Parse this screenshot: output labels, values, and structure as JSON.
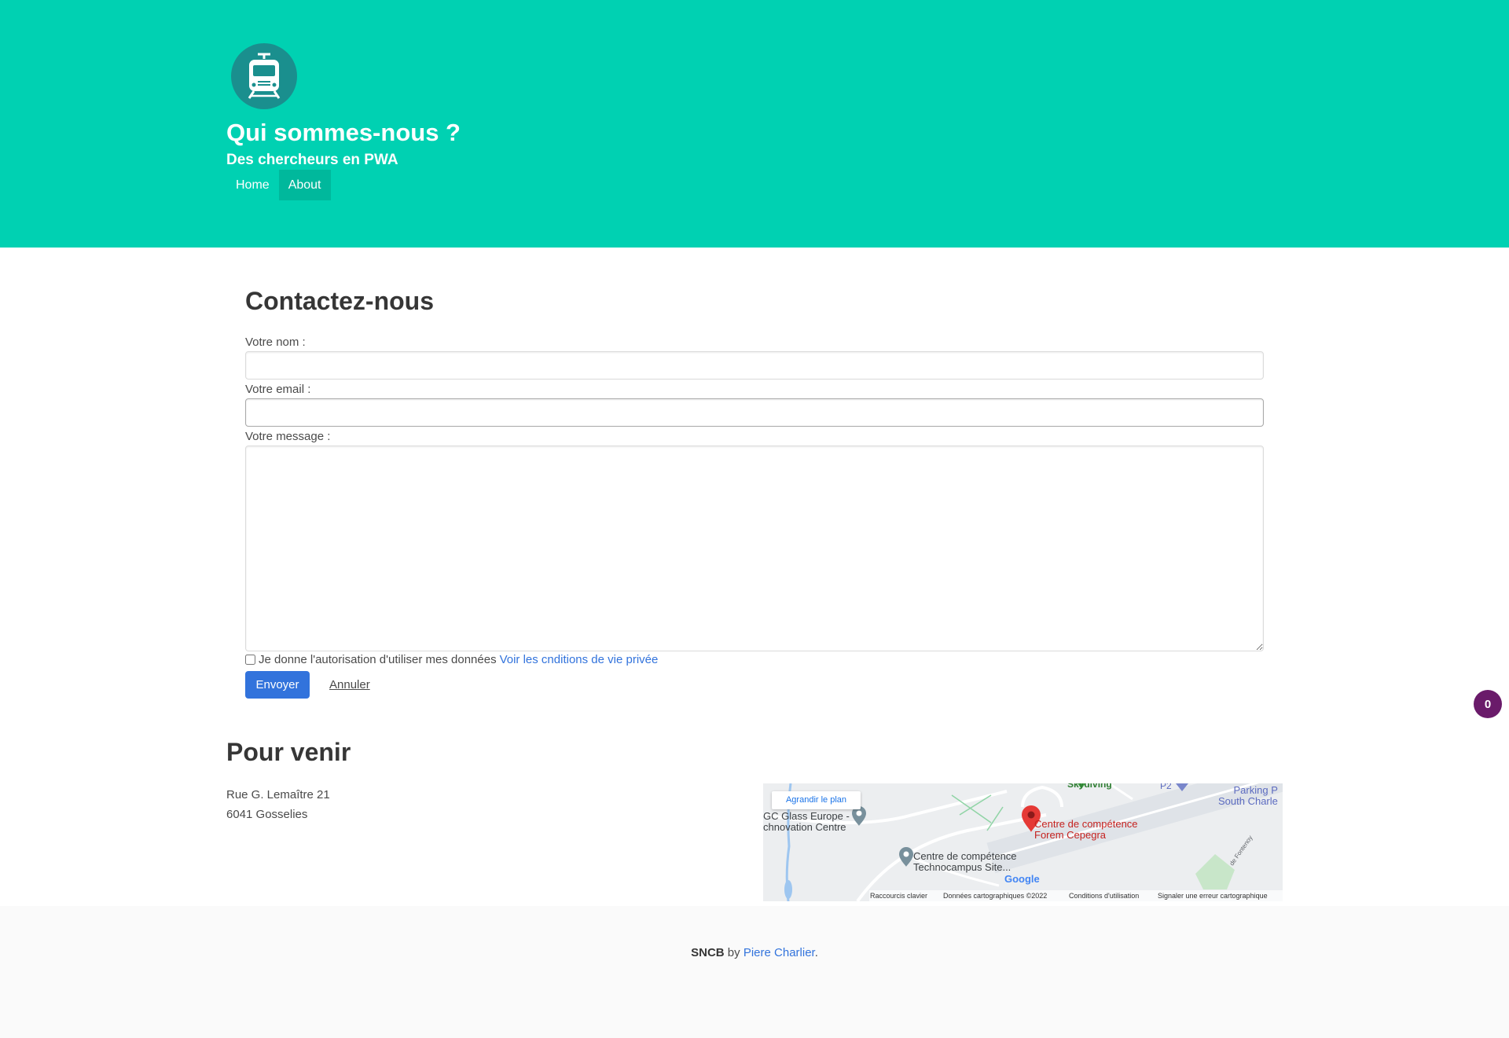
{
  "hero": {
    "logo_icon": "train-icon",
    "title": "Qui sommes-nous ?",
    "subtitle": "Des chercheurs en PWA",
    "nav": [
      {
        "label": "Home",
        "active": false
      },
      {
        "label": "About",
        "active": true
      }
    ],
    "background": "#00d1b2"
  },
  "contact": {
    "title": "Contactez-nous",
    "name_label": "Votre nom :",
    "name_value": "",
    "email_label": "Votre email :",
    "email_value": "",
    "message_label": "Votre message :",
    "message_value": "",
    "consent_text": "Je donne l'autorisation d'utiliser mes données",
    "consent_checked": false,
    "privacy_link": "Voir les cnditions de vie privée",
    "send_label": "Envoyer",
    "cancel_label": "Annuler"
  },
  "notification_badge": {
    "count": "0",
    "color": "#6a1b6a"
  },
  "directions": {
    "title": "Pour venir",
    "address_line1": "Rue G. Lemaître 21",
    "address_line2": "6041 Gosselies",
    "map": {
      "enlarge_label": "Agrandir le plan",
      "places": [
        {
          "name": "Centre de compétence Forem Cepegra",
          "line1": "Centre de compétence",
          "line2": "Forem Cepegra"
        },
        {
          "name": "AGC Glass Europe - Innovation Centre",
          "line1": "GC Glass Europe -",
          "line2": "chnovation Centre"
        },
        {
          "name": "Centre de compétence Technocampus Site",
          "line1": "Centre de compétence",
          "line2": "Technocampus Site..."
        },
        {
          "name": "Parking",
          "line1": "Parking P",
          "line2": "South Charle"
        },
        {
          "name": "Skydiving",
          "line1": "Skydiving",
          "line2": ""
        },
        {
          "name": "P2",
          "line1": "P2",
          "line2": ""
        }
      ],
      "road_label": "de Fontenoy",
      "google_label": "Google",
      "attribution": [
        "Raccourcis clavier",
        "Données cartographiques ©2022",
        "Conditions d'utilisation",
        "Signaler une erreur cartographique"
      ]
    }
  },
  "footer": {
    "brand": "SNCB",
    "by": " by ",
    "author": "Piere Charlier",
    "end": "."
  },
  "colors": {
    "primary": "#3273dc",
    "accent": "#00d1b2",
    "nav_active": "#00b89c"
  }
}
